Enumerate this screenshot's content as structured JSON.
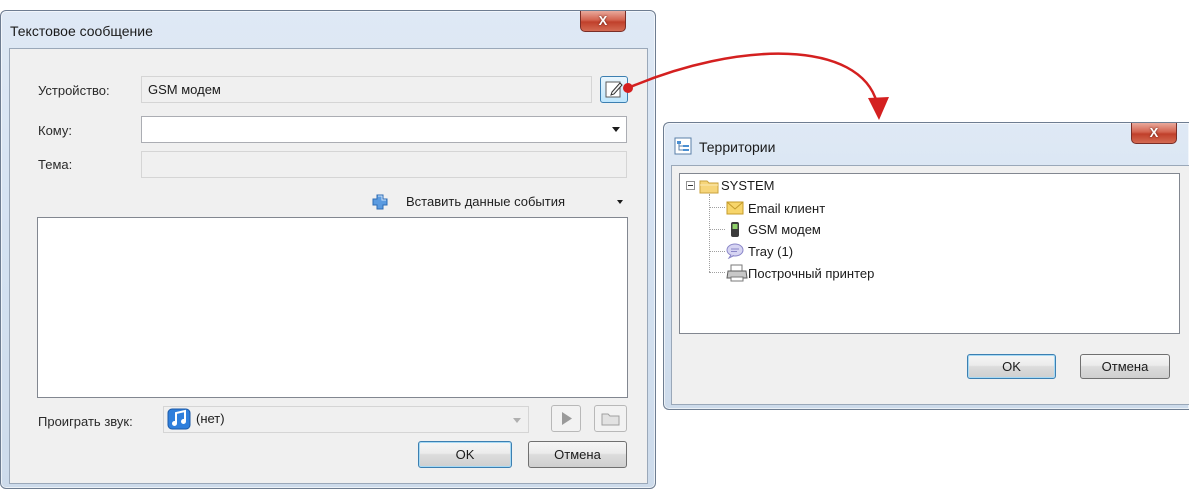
{
  "message_dialog": {
    "title": "Текстовое сообщение",
    "close_label": "X",
    "device_label": "Устройство:",
    "device_value": "GSM модем",
    "to_label": "Кому:",
    "to_value": "",
    "subject_label": "Тема:",
    "subject_value": "",
    "insert_event_label": "Вставить данные события",
    "body_value": "",
    "play_sound_label": "Проиграть звук:",
    "sound_value": "(нет)",
    "ok_label": "OK",
    "cancel_label": "Отмена"
  },
  "territories_dialog": {
    "title": "Территории",
    "close_label": "X",
    "tree": {
      "root": "SYSTEM",
      "children": [
        "Email клиент",
        "GSM модем",
        "Tray (1)",
        "Построчный принтер"
      ]
    },
    "ok_label": "OK",
    "cancel_label": "Отмена"
  },
  "colors": {
    "arrow": "#d42020",
    "accent": "#3c7fb1"
  },
  "icons": {
    "edit": "edit-icon",
    "plus": "plus-icon",
    "music": "music-note-icon",
    "play": "play-icon",
    "folder": "folder-icon",
    "tree": "tree-view-icon",
    "envelope": "envelope-icon",
    "phone": "mobile-phone-icon",
    "chat": "chat-bubble-icon",
    "printer": "printer-icon"
  }
}
